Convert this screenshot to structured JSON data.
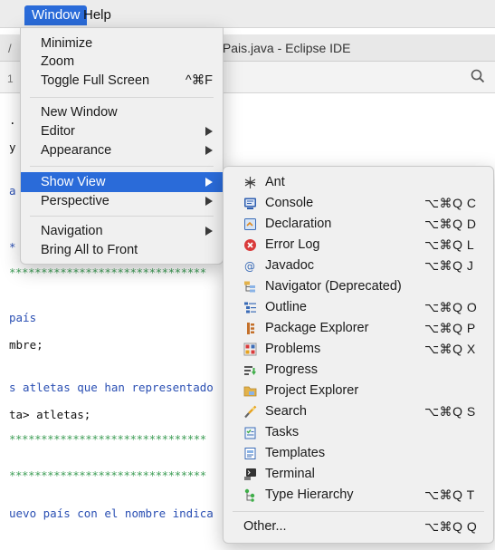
{
  "menubar": {
    "window_label": "Window",
    "help_label": "Help"
  },
  "titlebar": {
    "title": "/Pais.java - Eclipse IDE",
    "left_fragment": "/"
  },
  "toolbar": {
    "left_fragment": "1",
    "search_icon": "search-icon"
  },
  "editor": {
    "lines": [
      {
        "text": ".",
        "style": "plain"
      },
      {
        "text": "y",
        "style": "plain"
      },
      {
        "text": "a",
        "style": "blue"
      },
      {
        "text": "*",
        "style": "blue"
      },
      {
        "text": "*******************************",
        "style": "green"
      },
      {
        "text": "país",
        "style": "blue"
      },
      {
        "text": "mbre;",
        "style": "plain"
      },
      {
        "text": "s atletas que han representado",
        "style": "blue"
      },
      {
        "text": "ta> atletas;",
        "style": "plain"
      },
      {
        "text": "*******************************",
        "style": "green"
      },
      {
        "text": "*******************************",
        "style": "green"
      },
      {
        "text": "uevo país con el nombre indica",
        "style": "blue"
      }
    ]
  },
  "window_menu": {
    "items": [
      {
        "label": "Minimize"
      },
      {
        "label": "Zoom"
      },
      {
        "label": "Toggle Full Screen",
        "shortcut": "^⌘F"
      },
      {
        "label": "New Window"
      },
      {
        "label": "Editor",
        "submenu": true
      },
      {
        "label": "Appearance",
        "submenu": true
      },
      {
        "label": "Show View",
        "submenu": true,
        "highlighted": true
      },
      {
        "label": "Perspective",
        "submenu": true
      },
      {
        "label": "Navigation",
        "submenu": true
      },
      {
        "label": "Bring All to Front"
      }
    ]
  },
  "show_view_menu": {
    "items": [
      {
        "label": "Ant",
        "icon": "ant-icon",
        "shortcut": ""
      },
      {
        "label": "Console",
        "icon": "console-icon",
        "shortcut": "⌥⌘Q C"
      },
      {
        "label": "Declaration",
        "icon": "declaration-icon",
        "shortcut": "⌥⌘Q D"
      },
      {
        "label": "Error Log",
        "icon": "error-log-icon",
        "shortcut": "⌥⌘Q L"
      },
      {
        "label": "Javadoc",
        "icon": "javadoc-icon",
        "shortcut": "⌥⌘Q J"
      },
      {
        "label": "Navigator (Deprecated)",
        "icon": "navigator-icon",
        "shortcut": ""
      },
      {
        "label": "Outline",
        "icon": "outline-icon",
        "shortcut": "⌥⌘Q O"
      },
      {
        "label": "Package Explorer",
        "icon": "package-explorer-icon",
        "shortcut": "⌥⌘Q P"
      },
      {
        "label": "Problems",
        "icon": "problems-icon",
        "shortcut": "⌥⌘Q X"
      },
      {
        "label": "Progress",
        "icon": "progress-icon",
        "shortcut": ""
      },
      {
        "label": "Project Explorer",
        "icon": "project-explorer-icon",
        "shortcut": ""
      },
      {
        "label": "Search",
        "icon": "search-view-icon",
        "shortcut": "⌥⌘Q S"
      },
      {
        "label": "Tasks",
        "icon": "tasks-icon",
        "shortcut": ""
      },
      {
        "label": "Templates",
        "icon": "templates-icon",
        "shortcut": ""
      },
      {
        "label": "Terminal",
        "icon": "terminal-icon",
        "shortcut": ""
      },
      {
        "label": "Type Hierarchy",
        "icon": "type-hierarchy-icon",
        "shortcut": "⌥⌘Q T"
      },
      {
        "label": "Other...",
        "shortcut": "⌥⌘Q Q"
      }
    ]
  }
}
